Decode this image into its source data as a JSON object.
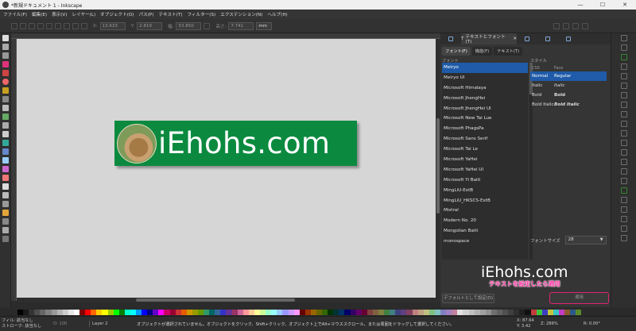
{
  "window": {
    "title": "*新規ドキュメント 1 - Inkscape",
    "controls": [
      "—",
      "☐",
      "✕"
    ]
  },
  "menu": [
    "ファイル(F)",
    "編集(E)",
    "表示(V)",
    "レイヤー(L)",
    "オブジェクト(O)",
    "パス(P)",
    "テキスト(T)",
    "フィルター(S)",
    "エクステンション(N)",
    "ヘルプ(H)"
  ],
  "toolbar": {
    "x_label": "X:",
    "x_value": "13.633",
    "y_label": "Y:",
    "y_value": "2.819",
    "w_label": "幅:",
    "w_value": "53.850",
    "h_label": "高さ:",
    "h_value": "7.741",
    "unit": "mm"
  },
  "canvas": {
    "banner_text": "iEhohs.com",
    "banner_color": "#0b8a3f"
  },
  "panel": {
    "active_tab": "テキストとフォント (T)",
    "close_glyph": "✕",
    "subtabs": [
      "フォント(F)",
      "機能(F)",
      "テキスト(T)"
    ],
    "font_heading": "フォント",
    "fonts": [
      "Meiryo",
      "Meiryo UI",
      "Microsoft Himalaya",
      "Microsoft JhengHei",
      "Microsoft JhengHei UI",
      "Microsoft New Tai Lue",
      "Microsoft PhagsPa",
      "Microsoft Sans Serif",
      "Microsoft Tai Le",
      "Microsoft YaHei",
      "Microsoft YaHei UI",
      "Microsoft Yi Baiti",
      "MingLiU-ExtB",
      "MingLiU_HKSCS-ExtB",
      "Mistral",
      "Modern No. 20",
      "Mongolian Baiti",
      "monospace"
    ],
    "selected_font": "Meiryo",
    "style_heading": "スタイル",
    "style_cols": [
      "CSS",
      "Face"
    ],
    "styles": [
      {
        "css": "Normal",
        "face": "Regular"
      },
      {
        "css": "Italic",
        "face": "Italic"
      },
      {
        "css": "Bold",
        "face": "Bold"
      },
      {
        "css": "Bold Italic",
        "face": "Bold Italic"
      }
    ],
    "font_size_label": "フォントサイズ",
    "font_size_value": "28",
    "preview_text": "iEhohs.com",
    "annotation": "テキストを設定したら適用",
    "default_button": "デフォルトとして設定(D)",
    "apply_button": "適用",
    "accent_color": "#1f5ba8",
    "highlight_color": "#e0246e"
  },
  "status": {
    "fill_label": "フィル:",
    "fill_value": "該当なし",
    "stroke_label": "ストローク:",
    "stroke_value": "該当なし",
    "opacity_label": "O:",
    "opacity_value": "100",
    "layer": "Layer 2",
    "message": "オブジェクトが選択されていません。オブジェクトをクリック、Shift+クリック、オブジェクト上でAlt+マウススクロール、または周囲をドラッグして選択してください。",
    "x_label": "X:",
    "x_value": "87.64",
    "y_label": "Y:",
    "y_value": "3.42",
    "zoom_label": "Z:",
    "zoom_value": "286%",
    "rot_label": "R:",
    "rot_value": "0.00°"
  },
  "palette_colors": [
    "#000000",
    "#1a1a1a",
    "#333333",
    "#4d4d4d",
    "#666666",
    "#808080",
    "#999999",
    "#b3b3b3",
    "#cccccc",
    "#e6e6e6",
    "#ffffff",
    "#800000",
    "#ff0000",
    "#ff6600",
    "#ffcc00",
    "#ffff00",
    "#99cc00",
    "#00ff00",
    "#008000",
    "#00ffcc",
    "#00ffff",
    "#0099ff",
    "#0000ff",
    "#000080",
    "#6600cc",
    "#ff00ff",
    "#cc0066",
    "#990033",
    "#cc3333",
    "#e65c00",
    "#cc9900",
    "#999900",
    "#669900",
    "#339966",
    "#006666",
    "#336699",
    "#3333cc",
    "#663399",
    "#993366",
    "#cc6699",
    "#ff9999",
    "#ffcc99",
    "#ffff99",
    "#ccff99",
    "#99ffcc",
    "#99ffff",
    "#99ccff",
    "#9999ff",
    "#cc99ff",
    "#ff99ff",
    "#660000",
    "#993300",
    "#996600",
    "#666600",
    "#336600",
    "#003300",
    "#003333",
    "#003366",
    "#000066",
    "#330066",
    "#660066",
    "#660033",
    "#804040",
    "#806040",
    "#808040",
    "#408040",
    "#408080",
    "#404080",
    "#604080",
    "#804060",
    "#c08080",
    "#c0a080",
    "#c0c080",
    "#80c080",
    "#80c0c0",
    "#8080c0",
    "#a080c0",
    "#c080a0",
    "#e0e0e0",
    "#d0d0d0",
    "#c0c0c0",
    "#b0b0b0",
    "#a0a0a0",
    "#909090",
    "#707070",
    "#606060",
    "#505050",
    "#404040",
    "#303030",
    "#202020",
    "#101010",
    "#c43c3c",
    "#3cc43c",
    "#3c3cc4",
    "#c4c43c",
    "#3cc4c4",
    "#c43cc4",
    "#8a5a2b",
    "#2b5a8a",
    "#5a8a2b"
  ]
}
